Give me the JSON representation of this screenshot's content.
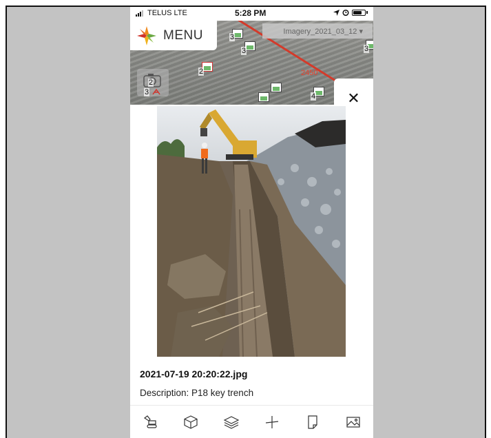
{
  "status_bar": {
    "carrier": "TELUS  LTE",
    "time": "5:28 PM"
  },
  "map": {
    "menu_label": "MENU",
    "imagery_selector": "Imagery_2021_03_12 ▾",
    "road_label": "2450",
    "markers": [
      {
        "count": "3"
      },
      {
        "count": "3"
      },
      {
        "count": "2"
      },
      {
        "count": "2"
      },
      {
        "count": "3"
      },
      {
        "count": "4"
      },
      {
        "count": "3"
      }
    ],
    "close_glyph": "✕"
  },
  "photo_panel": {
    "filename": "2021-07-19 20:20:22.jpg",
    "description": "Description: P18 key trench"
  },
  "toolbar": {
    "tools": [
      "excavator-icon",
      "box-icon",
      "layers-icon",
      "measure-icon",
      "note-icon",
      "image-icon"
    ]
  },
  "colors": {
    "road": "#d43a2a",
    "logo_orange": "#f08a1d",
    "logo_green": "#6aa842",
    "logo_red": "#d0342c"
  }
}
